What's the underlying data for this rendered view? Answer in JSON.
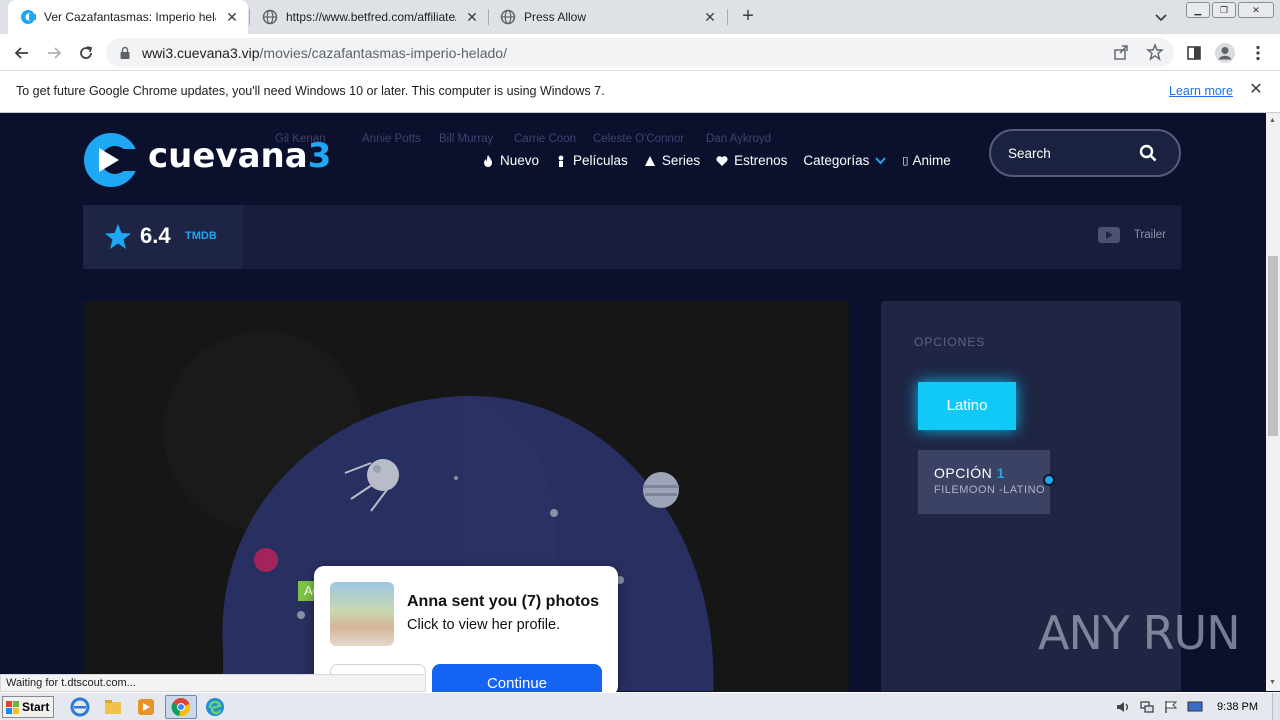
{
  "browser": {
    "tabs": [
      {
        "title": "Ver Cazafantasmas: Imperio helado",
        "active": true,
        "favicon": "cuevana-icon"
      },
      {
        "title": "https://www.betfred.com/affiliate/b",
        "active": false,
        "favicon": "globe-icon"
      },
      {
        "title": "Press Allow",
        "active": false,
        "favicon": "globe-icon"
      }
    ],
    "url_host": "wwi3.cuevana3.vip",
    "url_path": "/movies/cazafantasmas-imperio-helado/",
    "infobar": {
      "message": "To get future Google Chrome updates, you'll need Windows 10 or later. This computer is using Windows 7.",
      "link": "Learn more"
    },
    "status_text": "Waiting for t.dtscout.com..."
  },
  "site": {
    "logo_text": "cuevana",
    "logo_num": "3",
    "cast_top": [
      "Gil Kenan",
      "Annie Potts",
      "Bill Murray",
      "Carrie Coon",
      "Celeste O'Connor",
      "Dan Aykroyd"
    ],
    "nav": [
      {
        "label": "Nuevo",
        "icon": "fire-icon"
      },
      {
        "label": "Películas",
        "icon": "person-icon"
      },
      {
        "label": "Series",
        "icon": "triangle-icon"
      },
      {
        "label": "Estrenos",
        "icon": "heart-icon"
      },
      {
        "label": "Categorías",
        "icon": "chevron-down-icon"
      },
      {
        "label": "Anime",
        "icon": "box-icon"
      }
    ],
    "search_placeholder": "Search",
    "rating": {
      "score": "6.4",
      "source": "TMDB"
    },
    "trailer_label": "Trailer",
    "options": {
      "heading": "OPCIONES",
      "language": "Latino",
      "option_label": "OPCIÓN",
      "option_num": "1",
      "option_server": "FILEMOON -LATINO"
    }
  },
  "ad": {
    "badge": "Ad",
    "headline": "Anna sent you (7) photos",
    "subline": "Click to view her profile.",
    "cta": "Continue"
  },
  "watermark": "ANY RUN",
  "taskbar": {
    "start_label": "Start",
    "clock": "9:38 PM"
  },
  "colors": {
    "accent": "#1ea7f2",
    "page_bg": "#0b102d",
    "latino_button": "#10c9f7",
    "ad_cta": "#1463f3"
  }
}
